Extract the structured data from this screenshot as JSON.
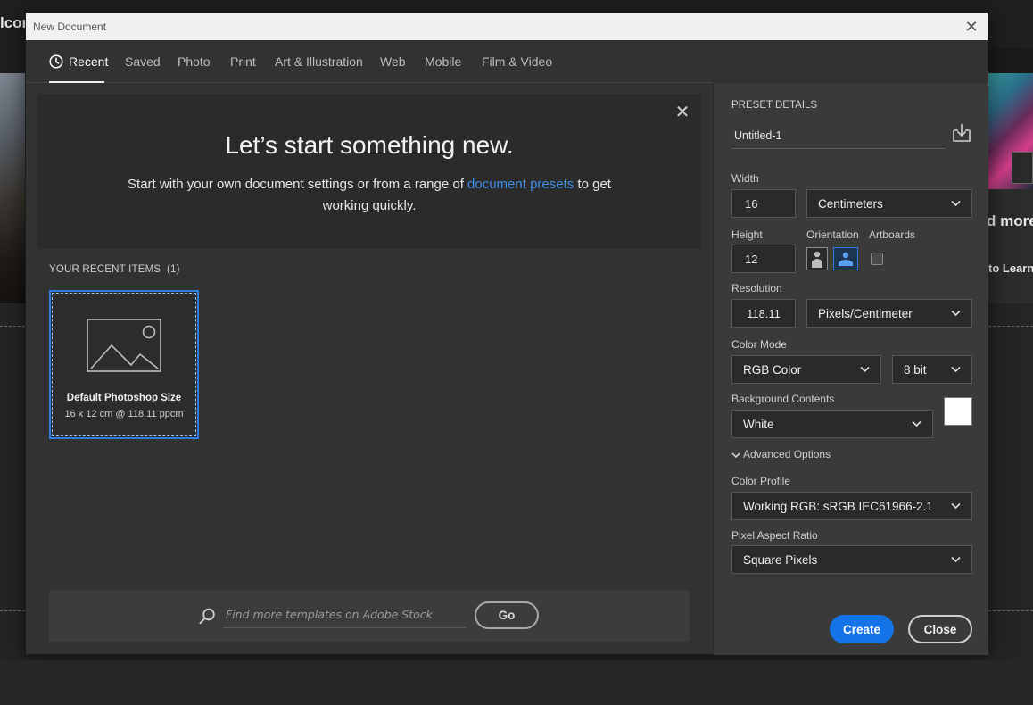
{
  "background": {
    "left_partial_text": "lcon",
    "right_heading_partial": "d more",
    "right_link_partial": "to Learn"
  },
  "dialog": {
    "title": "New Document",
    "tabs": [
      {
        "label": "Recent"
      },
      {
        "label": "Saved"
      },
      {
        "label": "Photo"
      },
      {
        "label": "Print"
      },
      {
        "label": "Art & Illustration"
      },
      {
        "label": "Web"
      },
      {
        "label": "Mobile"
      },
      {
        "label": "Film & Video"
      }
    ],
    "active_tab": "Recent"
  },
  "welcome": {
    "heading": "Let’s start something new.",
    "text_before": "Start with your own document settings or from a range of ",
    "link": "document presets",
    "text_after": " to get working quickly."
  },
  "recent": {
    "title": "YOUR RECENT ITEMS",
    "count": "(1)",
    "items": [
      {
        "name": "Default Photoshop Size",
        "meta": "16 x 12 cm @ 118.11 ppcm"
      }
    ]
  },
  "search": {
    "placeholder": "Find more templates on Adobe Stock",
    "go_label": "Go"
  },
  "preset": {
    "heading": "PRESET DETAILS",
    "name": "Untitled-1",
    "width_label": "Width",
    "width": "16",
    "width_unit": "Centimeters",
    "height_label": "Height",
    "height": "12",
    "orientation_label": "Orientation",
    "orientation_selected": "landscape",
    "artboards_label": "Artboards",
    "artboards_checked": false,
    "resolution_label": "Resolution",
    "resolution": "118.11",
    "resolution_unit": "Pixels/Centimeter",
    "color_mode_label": "Color Mode",
    "color_mode": "RGB Color",
    "bit_depth": "8 bit",
    "background_label": "Background Contents",
    "background": "White",
    "background_swatch": "#ffffff",
    "advanced_label": "Advanced Options",
    "color_profile_label": "Color Profile",
    "color_profile": "Working RGB: sRGB IEC61966-2.1",
    "pixel_aspect_label": "Pixel Aspect Ratio",
    "pixel_aspect": "Square Pixels"
  },
  "actions": {
    "create_label": "Create",
    "close_label": "Close"
  },
  "colors": {
    "accent": "#1473e6",
    "link": "#3d8ee8",
    "panel": "#323232",
    "sidebar": "#3a3a3a"
  }
}
